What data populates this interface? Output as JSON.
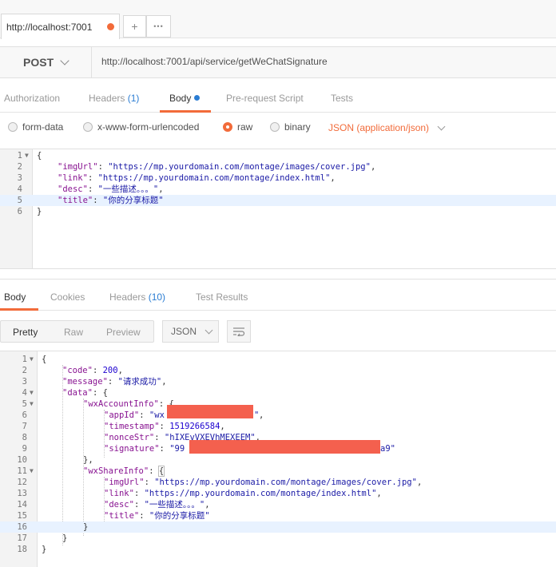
{
  "tab": {
    "title": "http://localhost:7001",
    "add": "+",
    "more": "•••"
  },
  "request": {
    "method": "POST",
    "url": "http://localhost:7001/api/service/getWeChatSignature"
  },
  "req_tabs": [
    {
      "label": "Authorization"
    },
    {
      "label": "Headers",
      "count": "(1)"
    },
    {
      "label": "Body"
    },
    {
      "label": "Pre-request Script"
    },
    {
      "label": "Tests"
    }
  ],
  "body_types": [
    "form-data",
    "x-www-form-urlencoded",
    "raw",
    "binary"
  ],
  "body_format": "JSON (application/json)",
  "request_body": {
    "l1": "{",
    "imgUrl_key": "\"imgUrl\"",
    "imgUrl_val": "\"https://mp.yourdomain.com/montage/images/cover.jpg\"",
    "link_key": "\"link\"",
    "link_val": "\"https://mp.yourdomain.com/montage/index.html\"",
    "desc_key": "\"desc\"",
    "desc_val": "\"一些描述。。。\"",
    "title_key": "\"title\"",
    "title_val": "\"你的分享标题\"",
    "l6": "}"
  },
  "resp_tabs": [
    {
      "label": "Body"
    },
    {
      "label": "Cookies"
    },
    {
      "label": "Headers",
      "count": "(10)"
    },
    {
      "label": "Test Results"
    }
  ],
  "view_modes": [
    "Pretty",
    "Raw",
    "Preview"
  ],
  "view_format": "JSON",
  "response_body": {
    "code_key": "\"code\"",
    "code_val": "200",
    "message_key": "\"message\"",
    "message_val": "\"请求成功\"",
    "data_key": "\"data\"",
    "wxAccountInfo_key": "\"wxAccountInfo\"",
    "appId_key": "\"appId\"",
    "appId_val_start": "\"wx",
    "appId_val_end": "\"",
    "timestamp_key": "\"timestamp\"",
    "timestamp_val": "1519266584",
    "nonceStr_key": "\"nonceStr\"",
    "nonceStr_val": "\"hIXEvVXEVhMEXEEM\"",
    "signature_key": "\"signature\"",
    "signature_val_start": "\"99",
    "signature_val_end": "a9\"",
    "wxShareInfo_key": "\"wxShareInfo\"",
    "imgUrl_key": "\"imgUrl\"",
    "imgUrl_val": "\"https://mp.yourdomain.com/montage/images/cover.jpg\"",
    "link_key": "\"link\"",
    "link_val": "\"https://mp.yourdomain.com/montage/index.html\"",
    "desc_key": "\"desc\"",
    "desc_val": "\"一些描述。。。\"",
    "title_key": "\"title\"",
    "title_val": "\"你的分享标题\""
  },
  "colors": {
    "accent": "#f26b3a",
    "count_blue": "#2b7dd3",
    "redaction": "#f4604e"
  }
}
